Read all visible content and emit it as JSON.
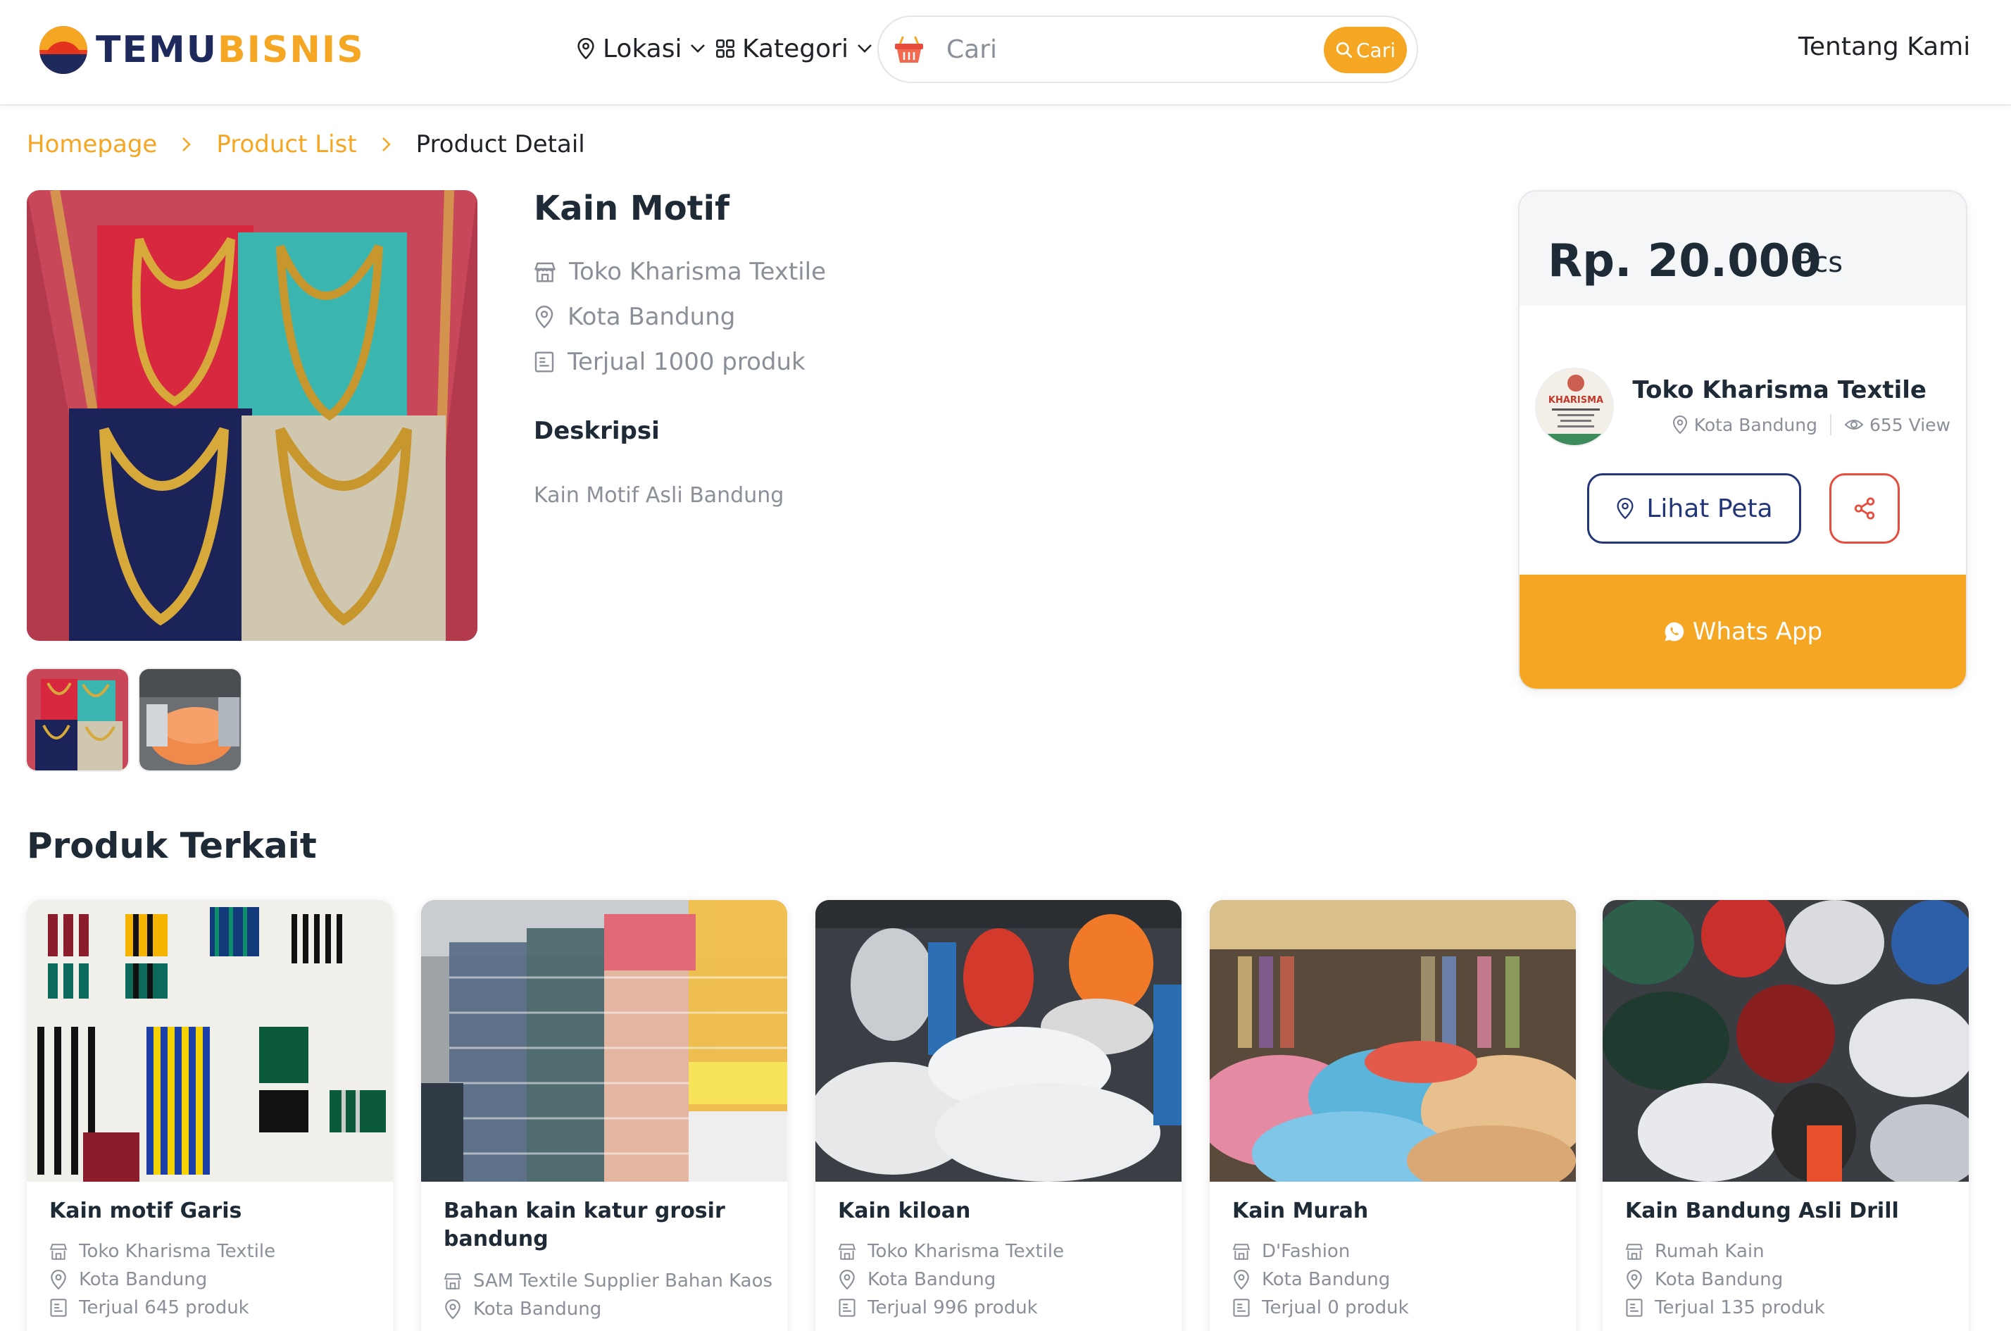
{
  "header": {
    "logo_part1": "TEMU",
    "logo_part2": "BISNIS",
    "nav_location": "Lokasi",
    "nav_category": "Kategori",
    "search_placeholder": "Cari",
    "search_button": "Cari",
    "about": "Tentang Kami"
  },
  "breadcrumb": {
    "home": "Homepage",
    "list": "Product List",
    "current": "Product Detail"
  },
  "product": {
    "title": "Kain Motif",
    "store": "Toko Kharisma Textile",
    "city": "Kota Bandung",
    "sold": "Terjual 1000 produk",
    "description_heading": "Deskripsi",
    "description": "Kain Motif Asli Bandung"
  },
  "price_card": {
    "price": "Rp. 20.000",
    "unit": "/ Pcs",
    "seller_name": "Toko Kharisma Textile",
    "seller_city": "Kota Bandung",
    "views": "655 View",
    "map_button": "Lihat Peta",
    "whatsapp_button": "Whats App",
    "seller_logo_text": "KHARISMA"
  },
  "related": {
    "heading": "Produk Terkait",
    "items": [
      {
        "name": "Kain motif Garis",
        "store": "Toko Kharisma Textile",
        "city": "Kota Bandung",
        "sold": "Terjual 645 produk"
      },
      {
        "name": "Bahan kain katur grosir bandung",
        "store": "SAM Textile Supplier Bahan Kaos",
        "city": "Kota Bandung",
        "sold": ""
      },
      {
        "name": "Kain kiloan",
        "store": "Toko Kharisma Textile",
        "city": "Kota Bandung",
        "sold": "Terjual 996 produk"
      },
      {
        "name": "Kain Murah",
        "store": "D'Fashion",
        "city": "Kota Bandung",
        "sold": "Terjual 0 produk"
      },
      {
        "name": "Kain Bandung Asli Drill",
        "store": "Rumah Kain",
        "city": "Kota Bandung",
        "sold": "Terjual 135 produk"
      }
    ]
  },
  "colors": {
    "accent": "#f5a623",
    "navy": "#24367a",
    "danger": "#e74c3c",
    "muted": "#8a8f98"
  }
}
